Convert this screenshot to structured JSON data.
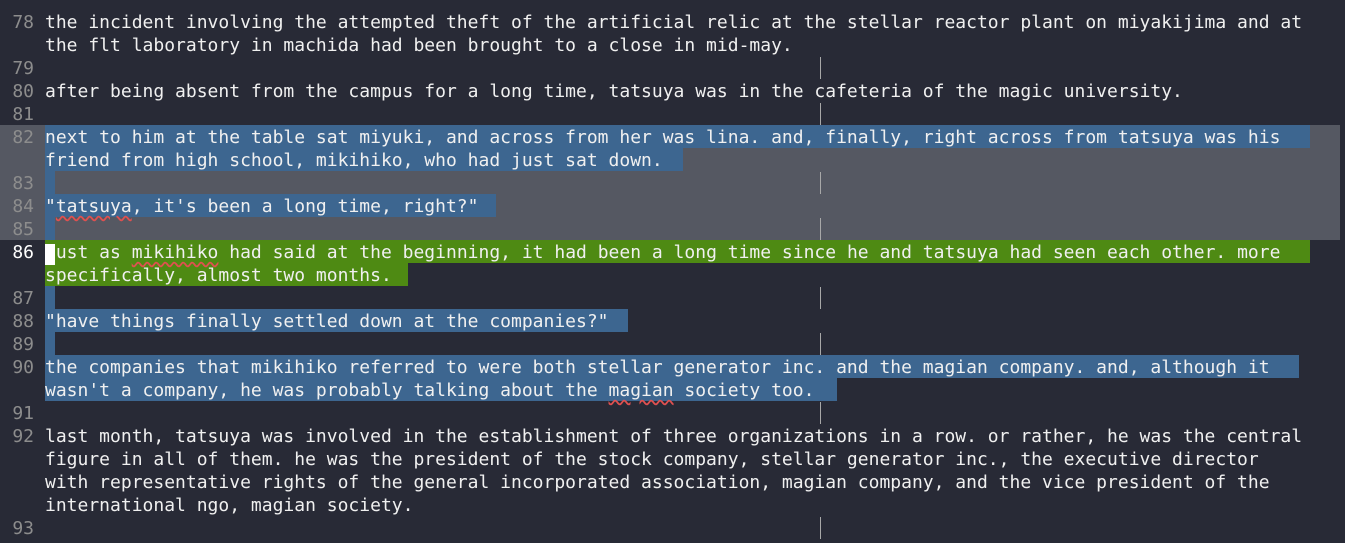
{
  "editor": {
    "lines": [
      {
        "num": "78",
        "rows": [
          "the incident involving the attempted theft of the artificial relic at the stellar reactor plant on miyakijima and at",
          "the flt laboratory in machida had been brought to a close in mid-may."
        ]
      },
      {
        "num": "79",
        "rows": [
          ""
        ]
      },
      {
        "num": "80",
        "rows": [
          "after being absent from the campus for a long time, tatsuya was in the cafeteria of the magic university."
        ]
      },
      {
        "num": "81",
        "rows": [
          ""
        ]
      },
      {
        "num": "82",
        "rows": [
          "next to him at the table sat miyuki, and across from her was lina. and, finally, right across from tatsuya was his",
          "friend from high school, mikihiko, who had just sat down."
        ]
      },
      {
        "num": "83",
        "rows": [
          ""
        ]
      },
      {
        "num": "84",
        "rows": [
          "\"tatsuya, it's been a long time, right?\""
        ]
      },
      {
        "num": "85",
        "rows": [
          ""
        ]
      },
      {
        "num": "86",
        "rows": [
          "just as mikihiko had said at the beginning, it had been a long time since he and tatsuya had seen each other. more",
          "specifically, almost two months."
        ]
      },
      {
        "num": "87",
        "rows": [
          ""
        ]
      },
      {
        "num": "88",
        "rows": [
          "\"have things finally settled down at the companies?\""
        ]
      },
      {
        "num": "89",
        "rows": [
          ""
        ]
      },
      {
        "num": "90",
        "rows": [
          "the companies that mikihiko referred to were both stellar generator inc. and the magian company. and, although it",
          "wasn't a company, he was probably talking about the magian society too."
        ]
      },
      {
        "num": "91",
        "rows": [
          ""
        ]
      },
      {
        "num": "92",
        "rows": [
          "last month, tatsuya was involved in the establishment of three organizations in a row. or rather, he was the central",
          "figure in all of them. he was the president of the stock company, stellar generator inc., the executive director",
          "with representative rights of the general incorporated association, magian company, and the vice president of the",
          "international ngo, magian society."
        ]
      },
      {
        "num": "93",
        "rows": [
          ""
        ]
      }
    ],
    "current_line": "86",
    "misspelled_words": [
      "tatsuya",
      "mikihiko",
      "magian"
    ],
    "colors": {
      "background": "#282a36",
      "selection": "#3d6690",
      "current_line_selection": "#4e8a13",
      "current_line_highlight": "#555862",
      "text": "#f0f0f0",
      "gutter_text": "#8d8d8d",
      "squiggle": "#e05050"
    }
  }
}
